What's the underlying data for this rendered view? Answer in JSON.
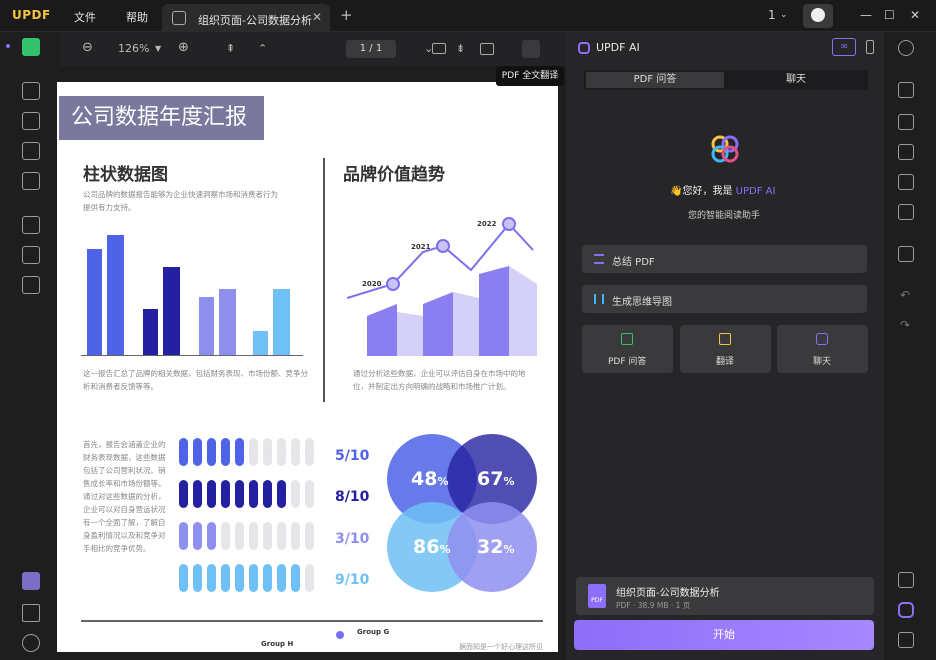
{
  "app": {
    "logo": "UPDF",
    "menu_file": "文件",
    "menu_help": "帮助"
  },
  "tab": {
    "title": "组织页面-公司数据分析",
    "close": "✕",
    "new": "+"
  },
  "window": {
    "page_counter": "1",
    "minimize": "—",
    "maximize": "☐",
    "close": "✕"
  },
  "toolbar": {
    "zoom_out": "⊖",
    "zoom": "126%",
    "zoom_in": "⊕",
    "page": "1 / 1",
    "tooltip": "PDF 全文翻译"
  },
  "doc": {
    "title": "公司数据年度汇报",
    "left_heading": "柱状数据图",
    "left_desc": "公司品牌的数据报告能够为企业快速洞察市场和消费者行为提供有力支持。",
    "left_footer": "这一报告汇总了品牌的相关数据，包括财务表现、市场份额、竞争分析和消费者反馈等等。",
    "right_heading": "品牌价值趋势",
    "right_footer": "通过分析这些数据，企业可以评估自身在市场中的地位，并制定出方向明确的战略和市场推广计划。",
    "body_text": "首先，报告会涵盖企业的财务表现数据，这些数据包括了公司营利状况、销售成长率和市场份额等。通过对这些数据的分析，企业可以对自身营运状况有一个全面了解，了解自身盈利情况以及和竞争对手相比的竞争优势。",
    "years": [
      "2020",
      "2021",
      "2022"
    ],
    "scores": [
      "5/10",
      "8/10",
      "3/10",
      "9/10"
    ],
    "venn": [
      "48",
      "67",
      "86",
      "32"
    ],
    "pct": "%",
    "group_h": "Group H",
    "group_g": "Group G",
    "tail": "据而知是一个好心理这所见"
  },
  "panel": {
    "title": "UPDF AI",
    "tab_qa": "PDF 问答",
    "tab_chat": "聊天",
    "greeting": "👋您好，我是",
    "brand": "UPDF AI",
    "subtitle": "您的智能阅读助手",
    "action_summary": "总结 PDF",
    "action_mindmap": "生成思维导图",
    "btn_qa": "PDF 问答",
    "btn_translate": "翻译",
    "btn_chat": "聊天",
    "file_name": "组织页面-公司数据分析",
    "file_meta": "PDF · 38.9 MB · 1 页",
    "start": "开始"
  },
  "colors": {
    "accent": "#8d6ef9",
    "green": "#32c36c",
    "purple_light": "#c9c3f5",
    "purple_dark": "#8b7ef0"
  }
}
